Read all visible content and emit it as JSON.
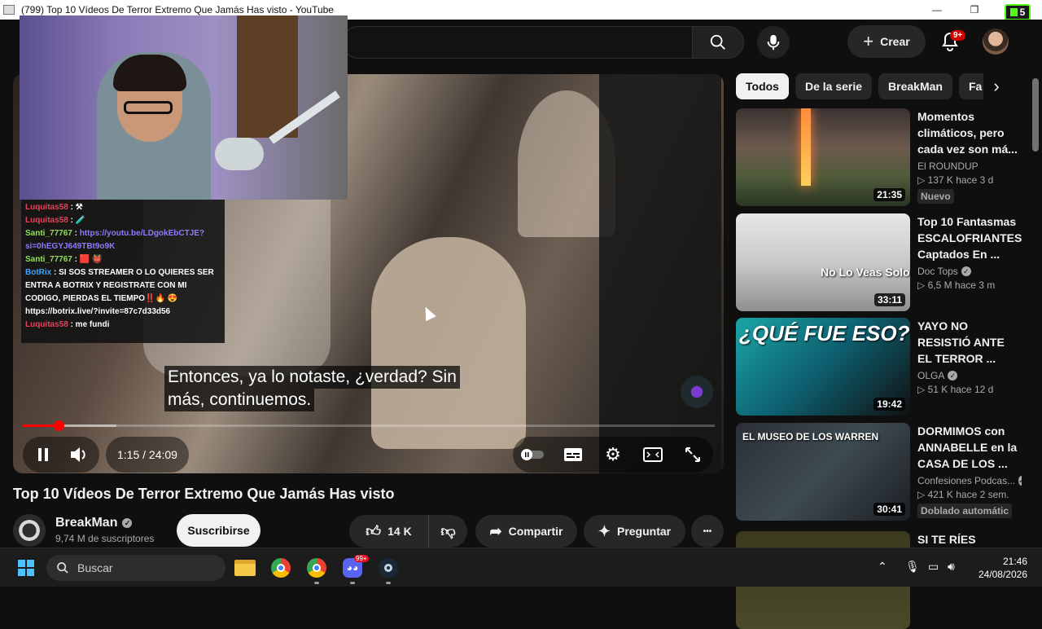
{
  "window": {
    "title": "(799) Top 10 Vídeos De Terror Extremo Que Jamás Has visto - YouTube",
    "minimize": "—",
    "maximize": "❐",
    "kick_badge": "5"
  },
  "header": {
    "create_label": "Crear",
    "notifications_badge": "9+",
    "icons": [
      "search-icon",
      "mic-icon",
      "plus-icon",
      "bell-icon"
    ]
  },
  "player": {
    "subtitle_line1": "Entonces, ya lo notaste, ¿verdad? Sin",
    "subtitle_line2": "más, continuemos.",
    "time": "1:15 / 24:09",
    "progress_fraction": 0.052,
    "buffered_fraction": 0.135,
    "chat": [
      {
        "user": "Luquitas58",
        "text": " : ⚒",
        "color": "u1"
      },
      {
        "user": "Luquitas58",
        "text": " : 🧪",
        "color": "u1"
      },
      {
        "user": "Santi_77767",
        "text": " : ",
        "link": "https://youtu.be/LDgokEbCTJE?si=0hEGYJ649TBt9o9K",
        "color": "u2"
      },
      {
        "user": "Santi_77767",
        "text": " : 🟥 👹",
        "color": "u2"
      },
      {
        "user": "BotRix",
        "text": " : SI SOS STREAMER O LO QUIERES SER ENTRA A BOTRIX Y REGISTRATE CON MI CODIGO, PIERDAS EL TIEMPO‼️🔥 😍https://botrix.live/?invite=87c7d33d56",
        "color": "u3"
      },
      {
        "user": "Luquitas58",
        "text": " : me fundi",
        "color": "u1"
      }
    ]
  },
  "video": {
    "title": "Top 10 Vídeos De Terror Extremo Que Jamás Has visto",
    "channel": "BreakMan",
    "subscribers": "9,74 M de suscriptores",
    "subscribe_label": "Suscribirse",
    "likes": "14 K",
    "share_label": "Compartir",
    "ask_label": "Preguntar",
    "more_label": "•••"
  },
  "chips": [
    "Todos",
    "De la serie",
    "BreakMan",
    "Fa"
  ],
  "recommendations": [
    {
      "title": "Momentos climáticos, pero cada vez son má...",
      "channel": "El ROUNDUP",
      "verified": false,
      "meta": "▷ 137 K  hace 3 d",
      "badge": "Nuevo",
      "duration": "21:35",
      "thumb_text": ""
    },
    {
      "title": "Top 10 Fantasmas ESCALOFRIANTES Captados En ...",
      "channel": "Doc Tops",
      "verified": true,
      "meta": "▷ 6,5 M  hace 3 m",
      "badge": "",
      "duration": "33:11",
      "thumb_text": "No Lo Veas Solo"
    },
    {
      "title": "YAYO NO RESISTIÓ ANTE EL TERROR ...",
      "channel": "OLGA",
      "verified": true,
      "meta": "▷ 51 K  hace 12 d",
      "badge": "",
      "duration": "19:42",
      "thumb_text": "¿QUÉ FUE ESO?"
    },
    {
      "title": "DORMIMOS con ANNABELLE en la CASA DE LOS ...",
      "channel": "Confesiones Podcas...",
      "verified": true,
      "meta": "▷ 421 K  hace 2 sem.",
      "badge": "Doblado automátic",
      "duration": "30:41",
      "thumb_text": "EL MUSEO DE LOS WARREN"
    },
    {
      "title": "SI TE RÍES",
      "channel": "",
      "verified": false,
      "meta": "",
      "badge": "",
      "duration": "",
      "thumb_text": ""
    }
  ],
  "taskbar": {
    "search_label": "Buscar",
    "discord_badge": "99+",
    "time": "21:46",
    "date": "24/08/2026"
  }
}
